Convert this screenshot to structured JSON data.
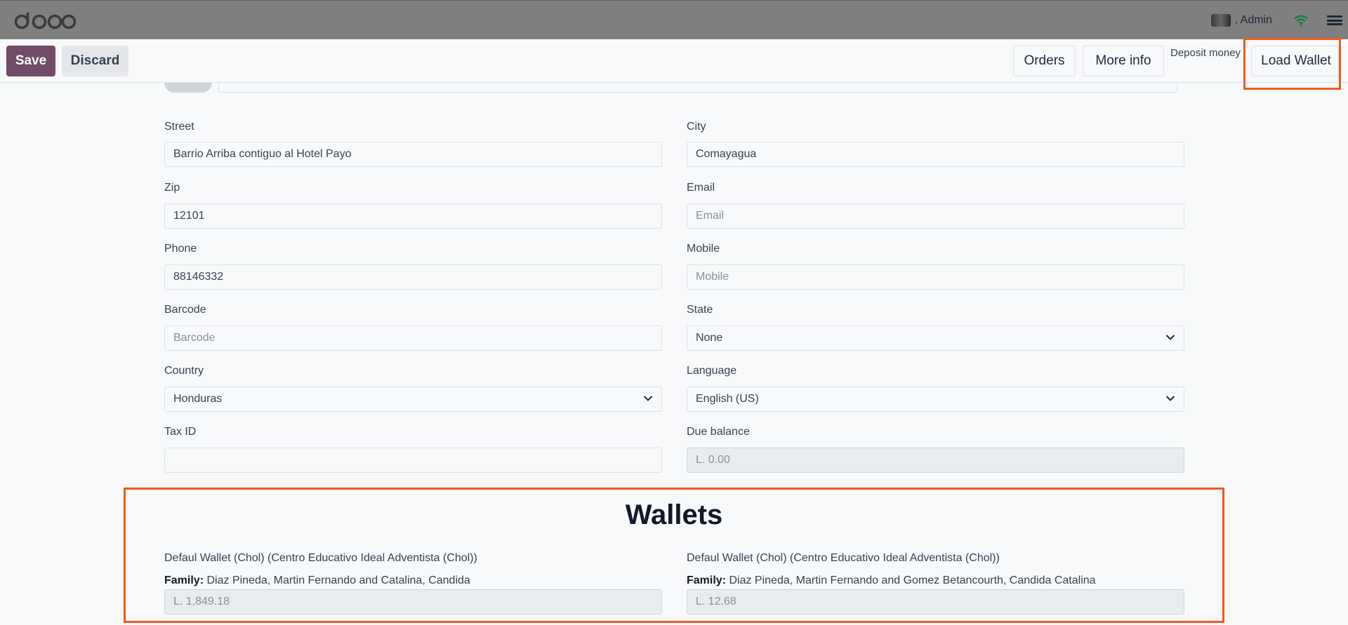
{
  "navbar": {
    "logo": "odoo",
    "user": ", Admin"
  },
  "control": {
    "save_label": "Save",
    "discard_label": "Discard",
    "orders_label": "Orders",
    "more_info_label": "More info",
    "deposit_label": "Deposit money",
    "load_wallet_label": "Load Wallet"
  },
  "form": {
    "street": {
      "label": "Street",
      "value": "Barrio Arriba contiguo al Hotel Payo"
    },
    "city": {
      "label": "City",
      "value": "Comayagua"
    },
    "zip": {
      "label": "Zip",
      "value": "12101"
    },
    "email": {
      "label": "Email",
      "placeholder": "Email"
    },
    "phone": {
      "label": "Phone",
      "value": "88146332"
    },
    "mobile": {
      "label": "Mobile",
      "placeholder": "Mobile"
    },
    "barcode": {
      "label": "Barcode",
      "placeholder": "Barcode"
    },
    "state": {
      "label": "State",
      "value": "None"
    },
    "country": {
      "label": "Country",
      "value": "Honduras"
    },
    "language": {
      "label": "Language",
      "value": "English (US)"
    },
    "tax_id": {
      "label": "Tax ID",
      "value": ""
    },
    "due_balance": {
      "label": "Due balance",
      "value": "L. 0.00"
    }
  },
  "wallets": {
    "title": "Wallets",
    "family_label": "Family:",
    "items": [
      {
        "name": "Defaul Wallet (Chol) (Centro Educativo Ideal Adventista (Chol))",
        "family": "Diaz Pineda, Martin Fernando and Catalina, Candida",
        "balance": "L. 1,849.18"
      },
      {
        "name": "Defaul Wallet (Chol) (Centro Educativo Ideal Adventista (Chol))",
        "family": "Diaz Pineda, Martin Fernando and Gomez Betancourth, Candida Catalina",
        "balance": "L. 12.68"
      }
    ]
  },
  "colors": {
    "navbar": "#7f7f7f",
    "primary": "#714b67",
    "highlight": "#ee5a1e",
    "wifi": "#15803d"
  },
  "icons": [
    "odoo-logo",
    "avatar",
    "wifi-icon",
    "hamburger-menu-icon",
    "chevron-down-icon"
  ]
}
